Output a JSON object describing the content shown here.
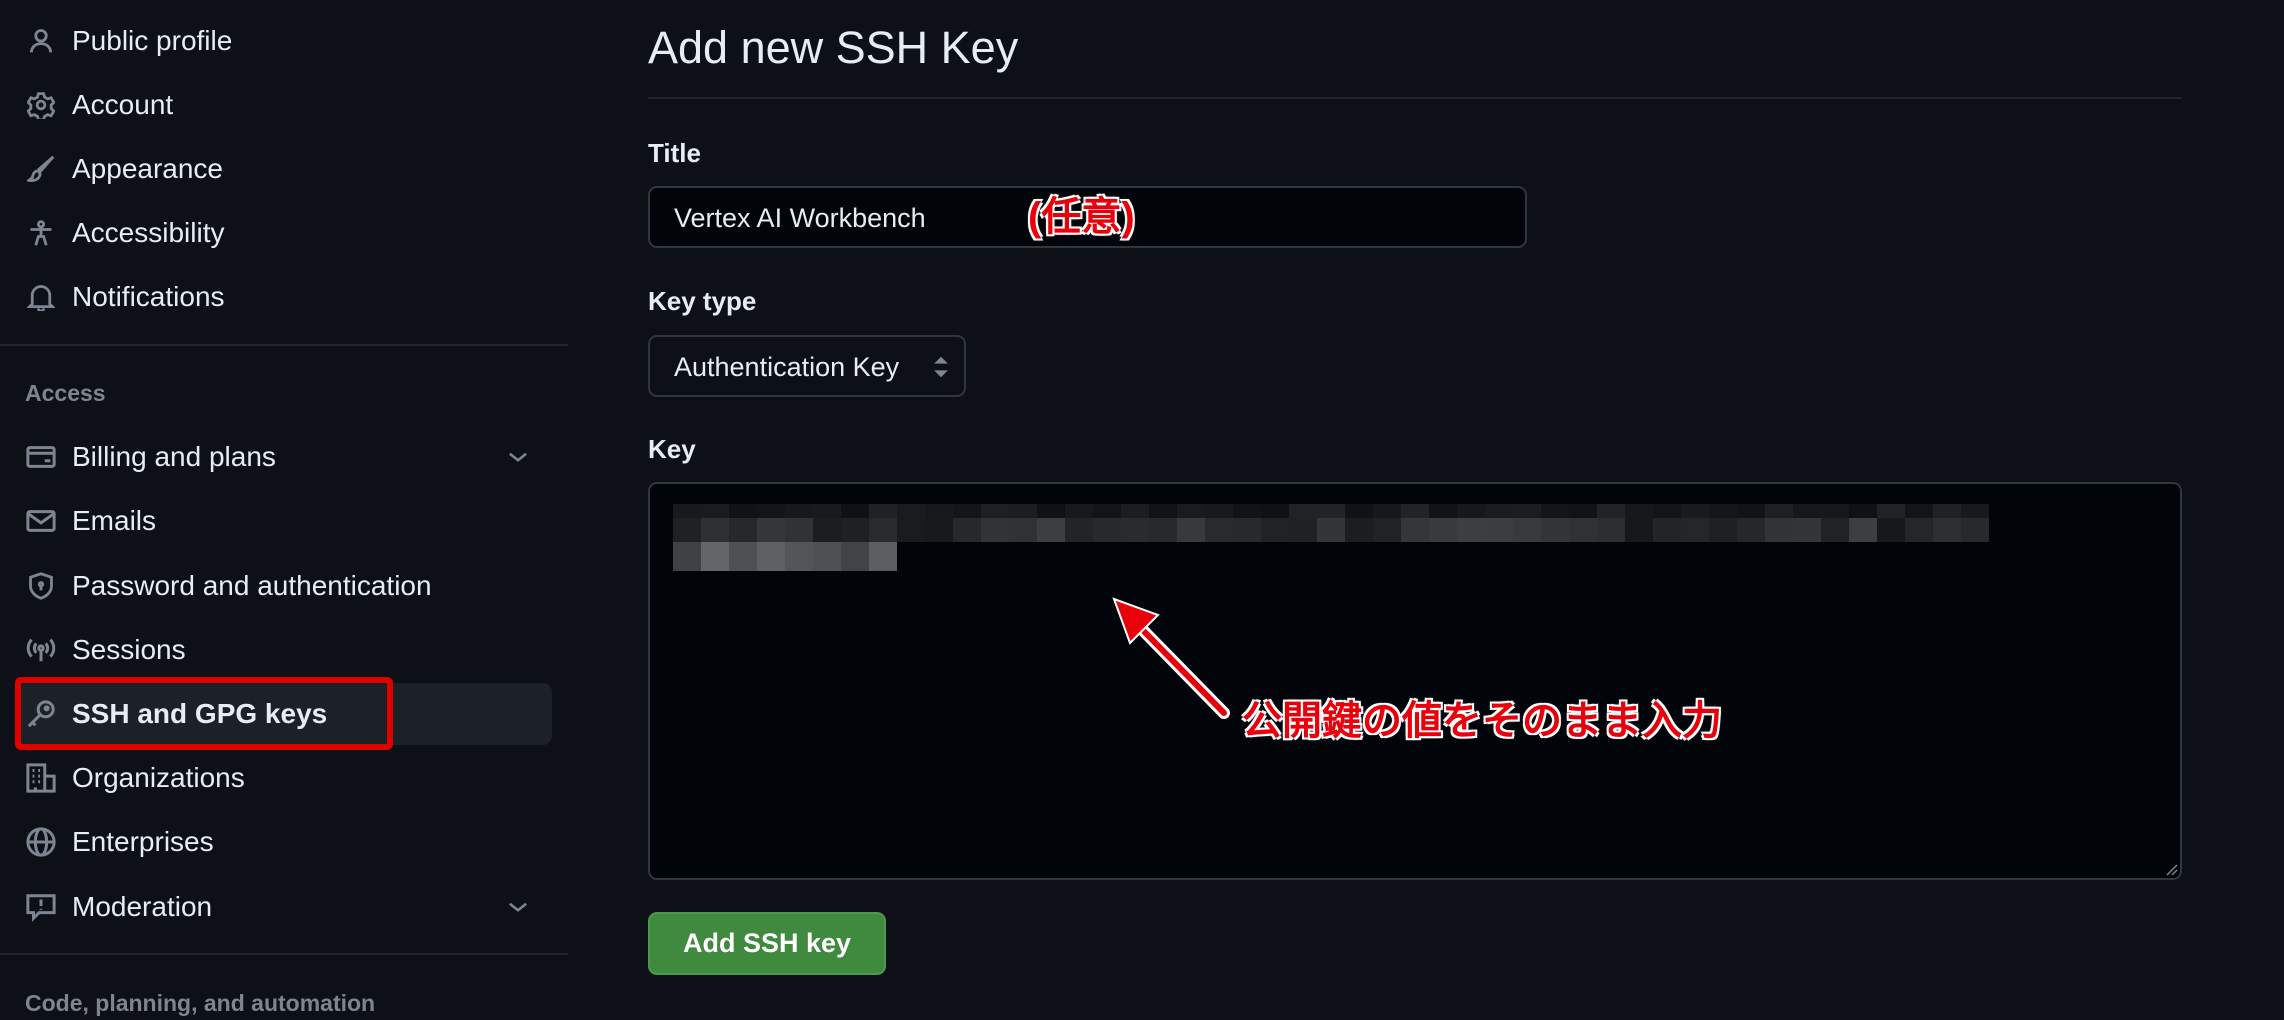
{
  "sidebar": {
    "items_top": [
      {
        "label": "Public profile",
        "icon": "person-icon"
      },
      {
        "label": "Account",
        "icon": "gear-icon"
      },
      {
        "label": "Appearance",
        "icon": "paintbrush-icon"
      },
      {
        "label": "Accessibility",
        "icon": "accessibility-icon"
      },
      {
        "label": "Notifications",
        "icon": "bell-icon"
      }
    ],
    "access_heading": "Access",
    "access_items": [
      {
        "label": "Billing and plans",
        "icon": "credit-card-icon",
        "expandable": true
      },
      {
        "label": "Emails",
        "icon": "mail-icon"
      },
      {
        "label": "Password and authentication",
        "icon": "shield-lock-icon"
      },
      {
        "label": "Sessions",
        "icon": "broadcast-icon"
      },
      {
        "label": "SSH and GPG keys",
        "icon": "key-icon",
        "active": true
      },
      {
        "label": "Organizations",
        "icon": "organization-icon"
      },
      {
        "label": "Enterprises",
        "icon": "globe-icon"
      },
      {
        "label": "Moderation",
        "icon": "report-icon",
        "expandable": true
      }
    ],
    "code_heading": "Code, planning, and automation"
  },
  "main": {
    "page_title": "Add new SSH Key",
    "title_label": "Title",
    "title_value": "Vertex AI Workbench",
    "key_type_label": "Key type",
    "key_type_value": "Authentication Key",
    "key_label": "Key",
    "key_value_blurred": true,
    "submit_label": "Add SSH key"
  },
  "annotations": {
    "title_note": "(任意)",
    "key_note": "公開鍵の値をそのまま入力",
    "color": "#e8000b"
  },
  "colors": {
    "accent_button": "#3f8a3f",
    "highlight_box": "#e00000"
  }
}
